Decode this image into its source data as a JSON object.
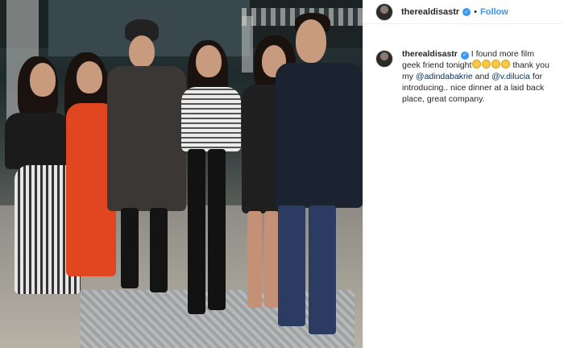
{
  "post": {
    "username": "therealdisastr",
    "follow_label": "Follow",
    "separator": "•"
  },
  "caption": {
    "username": "therealdisastr",
    "text_1": "I found more film geek friend tonight",
    "emoji_count": 4,
    "text_2": " thank you my ",
    "mention_1": "@adindabakrie",
    "text_3": " and ",
    "mention_2": "@v.dilucia",
    "text_4": " for introducing.. nice dinner at a laid back place, great company."
  },
  "icons": {
    "verified": "verified-badge-icon",
    "avatar": "profile-avatar",
    "emoji": "laughing-face-emoji"
  },
  "colors": {
    "link_blue": "#3897f0",
    "mention": "#003569",
    "text": "#262626"
  }
}
